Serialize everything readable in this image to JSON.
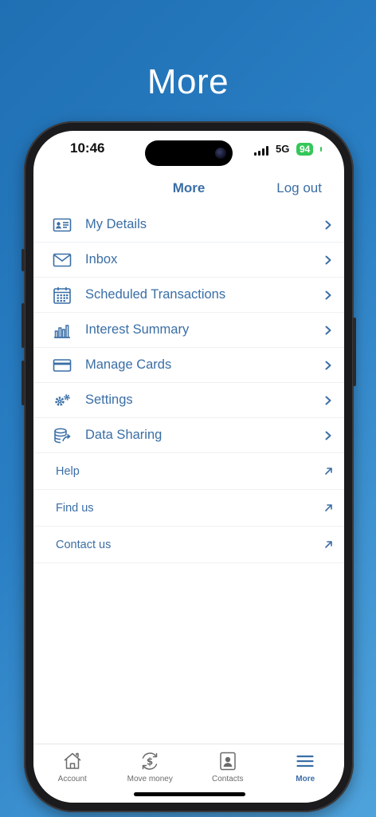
{
  "hero": {
    "title": "More"
  },
  "status_bar": {
    "time": "10:46",
    "network": "5G",
    "battery": "94"
  },
  "header": {
    "title": "More",
    "logout_label": "Log out"
  },
  "menu": {
    "items": [
      {
        "label": "My Details",
        "icon": "id-card-icon"
      },
      {
        "label": "Inbox",
        "icon": "envelope-icon"
      },
      {
        "label": "Scheduled Transactions",
        "icon": "calendar-icon"
      },
      {
        "label": "Interest Summary",
        "icon": "bar-chart-icon"
      },
      {
        "label": "Manage Cards",
        "icon": "credit-card-icon"
      },
      {
        "label": "Settings",
        "icon": "gears-icon"
      },
      {
        "label": "Data Sharing",
        "icon": "database-share-icon"
      }
    ],
    "links": [
      {
        "label": "Help"
      },
      {
        "label": "Find us"
      },
      {
        "label": "Contact us"
      }
    ]
  },
  "tabs": [
    {
      "label": "Account",
      "icon": "home-icon",
      "active": false
    },
    {
      "label": "Move money",
      "icon": "dollar-transfer-icon",
      "active": false
    },
    {
      "label": "Contacts",
      "icon": "contact-card-icon",
      "active": false
    },
    {
      "label": "More",
      "icon": "hamburger-menu-icon",
      "active": true
    }
  ],
  "colors": {
    "accent": "#3a6ea5",
    "background_gradient_start": "#1f6fb3",
    "background_gradient_end": "#4fa3dc",
    "battery": "#34c759"
  }
}
